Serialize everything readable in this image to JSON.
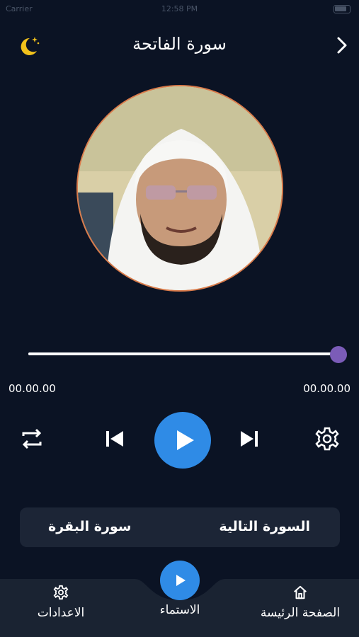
{
  "status_bar": {
    "carrier": "Carrier",
    "time": "12:58 PM"
  },
  "header": {
    "title": "سورة الفاتحة"
  },
  "player": {
    "progress": 1.0,
    "time_elapsed": "00.00.00",
    "time_total": "00.00.00"
  },
  "controls": {
    "repeat_icon": "repeat-icon",
    "prev_icon": "skip-previous-icon",
    "play_icon": "play-icon",
    "next_icon": "skip-next-icon",
    "settings_icon": "gear-icon"
  },
  "surah_nav": {
    "current": "سورة البقرة",
    "next_label": "السورة التالية"
  },
  "bottom_nav": {
    "settings": "الاعدادات",
    "listen": "الاستماء",
    "home": "الصفحة الرئيسة"
  },
  "colors": {
    "background": "#0b1324",
    "accent": "#2f8be6",
    "thumb": "#7b5cb8",
    "moon": "#f2c21b",
    "card": "#1c2536"
  }
}
